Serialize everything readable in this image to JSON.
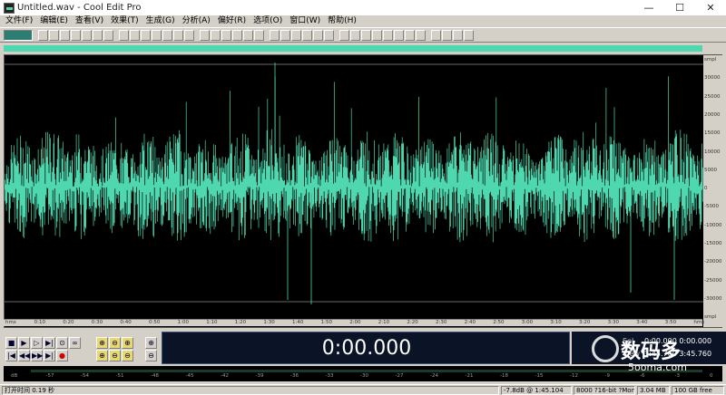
{
  "window": {
    "title": "Untitled.wav - Cool Edit Pro",
    "minimize": "—",
    "maximize": "☐",
    "close": "✕"
  },
  "menu": [
    "文件(F)",
    "编辑(E)",
    "查看(V)",
    "效果(T)",
    "生成(G)",
    "分析(A)",
    "偏好(R)",
    "选项(O)",
    "窗口(W)",
    "帮助(H)"
  ],
  "toolbar": {
    "button_count": 38
  },
  "colors": {
    "waveform": "#4fd8b0",
    "background": "#000000",
    "time_display_bg": "#0b1426"
  },
  "waveform": {
    "y_ticks": [
      "smpl",
      "30000",
      "25000",
      "20000",
      "15000",
      "10000",
      "5000",
      "0",
      "-5000",
      "-10000",
      "-15000",
      "-20000",
      "-25000",
      "-30000",
      "smpl"
    ],
    "x_ticks": [
      "hms",
      "0:10",
      "0:20",
      "0:30",
      "0:40",
      "0:50",
      "1:00",
      "1:10",
      "1:20",
      "1:30",
      "1:40",
      "1:50",
      "2:00",
      "2:10",
      "2:20",
      "2:30",
      "2:40",
      "2:50",
      "3:00",
      "3:10",
      "3:20",
      "3:30",
      "3:40",
      "3:50",
      "hms"
    ]
  },
  "transport": {
    "buttons_row1": [
      "■",
      "▶",
      "▷",
      "▶|",
      "⊙"
    ],
    "buttons_row2": [
      "|◀",
      "◀◀",
      "▶▶",
      "▶|",
      "●"
    ],
    "zoom_row1": [
      "⊕",
      "⊖",
      "⊕",
      "⊕"
    ],
    "zoom_row2": [
      "⊕",
      "⊖",
      "⊖",
      "⊖"
    ],
    "time": "0:00.000",
    "sel_labels": [
      "Sel",
      "View"
    ],
    "sel_values": [
      "0:00.000  0:00.000",
      "3:45.760  3:45.760"
    ]
  },
  "level_meter": {
    "ticks": [
      "dB",
      "-57",
      "-54",
      "-51",
      "-48",
      "-45",
      "-42",
      "-39",
      "-36",
      "-33",
      "-30",
      "-27",
      "-24",
      "-21",
      "-18",
      "-15",
      "-12",
      "-9",
      "-6",
      "-3",
      "0"
    ]
  },
  "status": {
    "left": "打开时间 0.19 秒",
    "db": "-7.8dB @ 1:45.104",
    "format": "8000 ?16-bit ?Mono",
    "size": "3.04 MB",
    "free": "100 GB free"
  },
  "watermark": {
    "text": "数码多",
    "url": "5ooma.com"
  }
}
